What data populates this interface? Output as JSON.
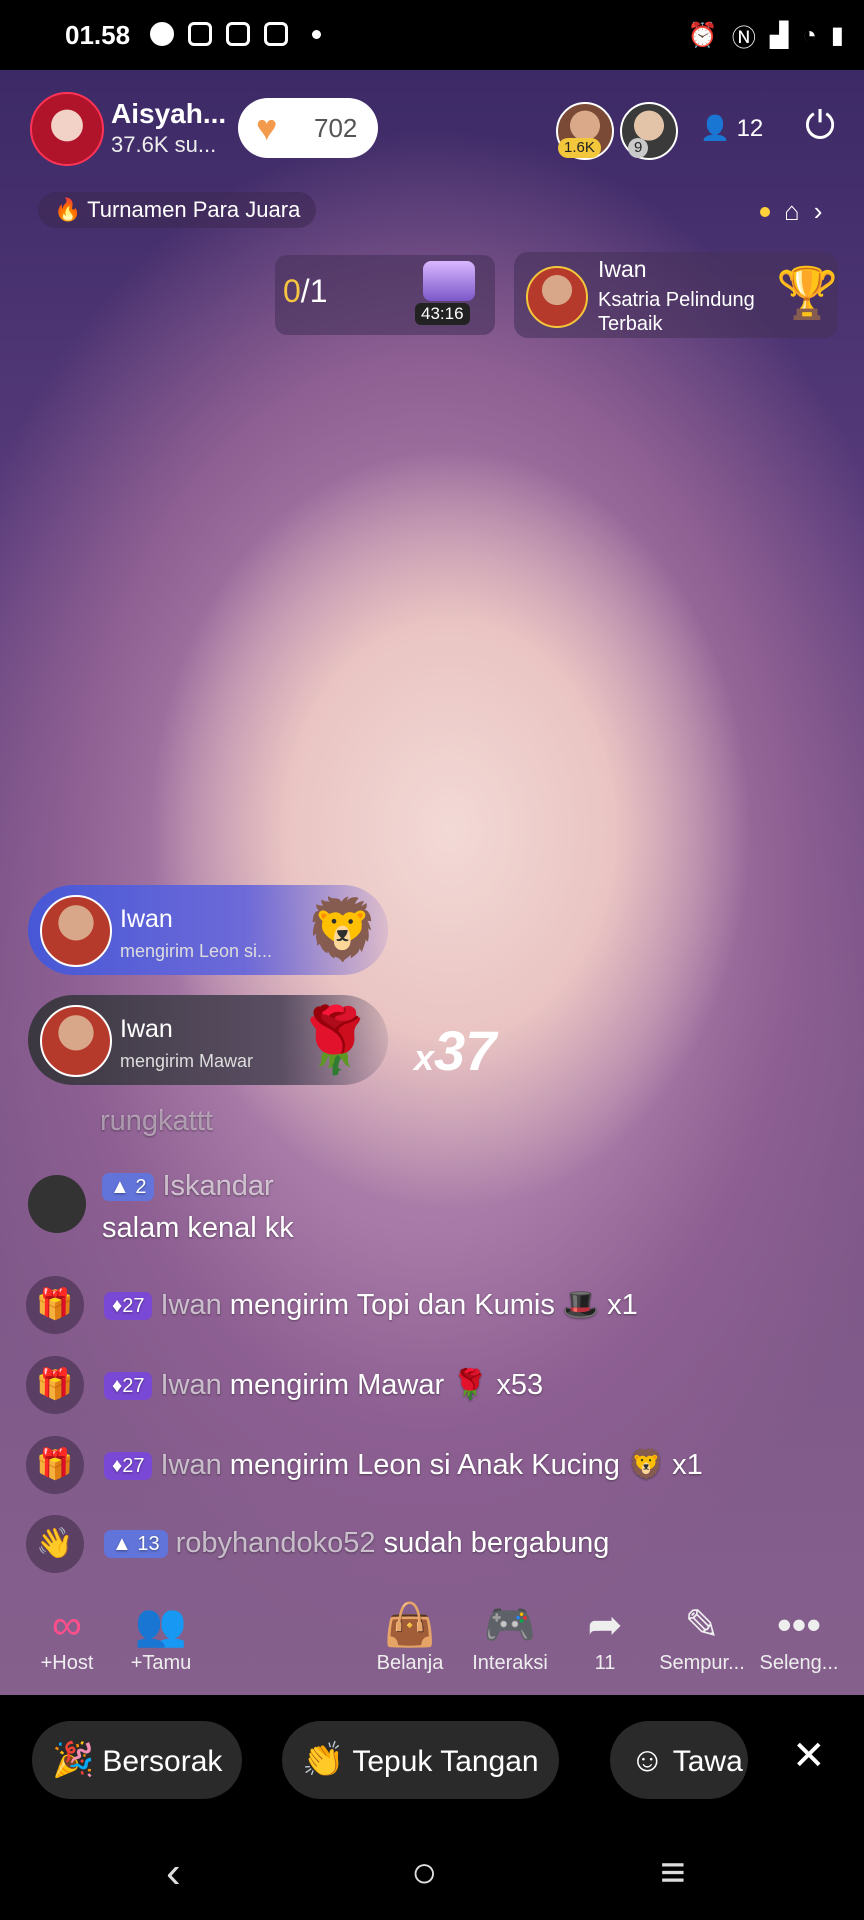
{
  "status": {
    "time": "01.58"
  },
  "host": {
    "name": "Aisyah...",
    "subtitle": "37.6K su...",
    "likes": "702"
  },
  "viewers": {
    "badge1": "1.6K",
    "badge2": "9",
    "count": "12"
  },
  "tournament": {
    "label": "Turnamen Para Juara"
  },
  "battle": {
    "score_current": "0",
    "score_total": "/1",
    "timer": "43:16"
  },
  "champion": {
    "name": "Iwan",
    "title": "Ksatria Pelindung Terbaik"
  },
  "gift_banners": [
    {
      "name": "Iwan",
      "desc": "mengirim Leon si..."
    },
    {
      "name": "Iwan",
      "desc": "mengirim Mawar"
    }
  ],
  "combo": {
    "prefix": "x",
    "count": "37"
  },
  "chat": {
    "faded_line": "rungkattt",
    "message": {
      "level": "2",
      "user": "Iskandar",
      "text": "salam kenal kk"
    },
    "gifts": [
      {
        "level": "27",
        "user": "Iwan",
        "text": "mengirim Topi dan Kumis",
        "count": "x1"
      },
      {
        "level": "27",
        "user": "Iwan",
        "text": "mengirim Mawar",
        "count": "x53"
      },
      {
        "level": "27",
        "user": "Iwan",
        "text": "mengirim Leon si Anak Kucing",
        "count": "x1"
      }
    ],
    "join": {
      "level": "13",
      "user": "robyhandoko52",
      "text": "sudah bergabung"
    }
  },
  "toolbar": {
    "host": "+Host",
    "guest": "+Tamu",
    "shop": "Belanja",
    "interact": "Interaksi",
    "share": "11",
    "perfect": "Sempur...",
    "more": "Seleng..."
  },
  "reactions": {
    "cheer": "Bersorak",
    "clap": "Tepuk Tangan",
    "laugh": "Tawa"
  },
  "colors": {
    "accent": "#ff4f8b",
    "level_badge": "#7846dc",
    "likes_heart": "#f39a4c"
  }
}
